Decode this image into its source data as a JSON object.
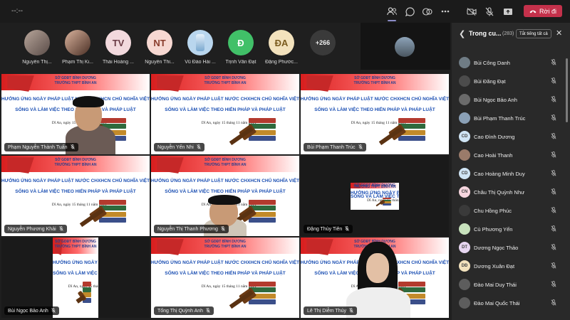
{
  "topbar": {
    "timer": "--:--",
    "leave_label": "Rời đi",
    "colors": {
      "leave": "#c4314b",
      "accent": "#8b8cc7"
    }
  },
  "strip": {
    "participants": [
      {
        "name": "Nguyễn Thị...",
        "initials": "",
        "color": "#7a6f6c"
      },
      {
        "name": "Phạm Thị Ki...",
        "initials": "",
        "color": "#8a6a55"
      },
      {
        "name": "Thái Hoàng ...",
        "initials": "TV",
        "color": "#f2d9dd"
      },
      {
        "name": "Nguyễn Thi...",
        "initials": "NT",
        "color": "#f7d8d2"
      },
      {
        "name": "Vũ Đào Hải ...",
        "initials": "",
        "color": "#b9d6ee"
      },
      {
        "name": "Trịnh Văn Đạt",
        "initials": "Đ",
        "color": "#41c068"
      },
      {
        "name": "Đặng Phước...",
        "initials": "ĐA",
        "color": "#f3e2bd"
      }
    ],
    "more_count": "+266"
  },
  "slide": {
    "line1": "SỞ GDĐT BÌNH DƯƠNG",
    "line2": "TRƯỜNG THPT BÌNH AN",
    "line3": "HƯỞNG ỨNG NGÀY PHÁP LUẬT NƯỚC CHXHCN CHỦ NGHĨA VIỆT NAM",
    "line4": "SỐNG VÀ LÀM VIỆC THEO HIẾN PHÁP VÀ PHÁP LUẬT",
    "date": "Dĩ An, ngày 15 tháng 11 năm 2021"
  },
  "tiles": [
    {
      "name": "Phạm Nguyễn Thành Tuấn"
    },
    {
      "name": "Nguyễn Yến Nhi"
    },
    {
      "name": "Bùi Phạm Thanh Trúc"
    },
    {
      "name": "Nguyễn Phương Khải"
    },
    {
      "name": "Nguyễn Thị Thanh Phương"
    },
    {
      "name": "Đặng Thùy Tiên"
    },
    {
      "name": "Bùi Ngọc Bảo Anh"
    },
    {
      "name": "Tống Thị Quỳnh Anh"
    },
    {
      "name": "Lê Thị Diễm Thúy"
    }
  ],
  "panel": {
    "title": "Trong cu...",
    "count": "(283)",
    "mute_all_label": "Tắt tiếng tất cả",
    "people": [
      {
        "name": "Bùi Công Danh",
        "initials": "",
        "color": "#6f7c85"
      },
      {
        "name": "Bùi Đăng Đạt",
        "initials": "",
        "color": "#4c4c4c"
      },
      {
        "name": "Bùi Ngọc Bảo Anh",
        "initials": "",
        "color": "#6a6a6a"
      },
      {
        "name": "Bùi Phạm Thanh Trúc",
        "initials": "",
        "color": "#8aa0b6"
      },
      {
        "name": "Cao Đình Dương",
        "initials": "CD",
        "color": "#cfe4f4"
      },
      {
        "name": "Cao Hoài Thanh",
        "initials": "",
        "color": "#9a7b6a"
      },
      {
        "name": "Cao Hoàng Minh Duy",
        "initials": "CD",
        "color": "#cfe4f4"
      },
      {
        "name": "Châu Thị Quỳnh Như",
        "initials": "CN",
        "color": "#f6d5de"
      },
      {
        "name": "Chu Hồng Phúc",
        "initials": "",
        "color": "#3a3a3a"
      },
      {
        "name": "Cù Phương Yến",
        "initials": "",
        "color": "#c8e2bd"
      },
      {
        "name": "Dương Ngọc Thảo",
        "initials": "DT",
        "color": "#e6d5f0"
      },
      {
        "name": "Dương Xuân Đạt",
        "initials": "DĐ",
        "color": "#f3e2bd"
      },
      {
        "name": "Đào Mai Duy Thái",
        "initials": "",
        "color": "#5d5d5d"
      },
      {
        "name": "Đào Mai Quốc Thái",
        "initials": "",
        "color": "#5d5d5d"
      }
    ]
  }
}
